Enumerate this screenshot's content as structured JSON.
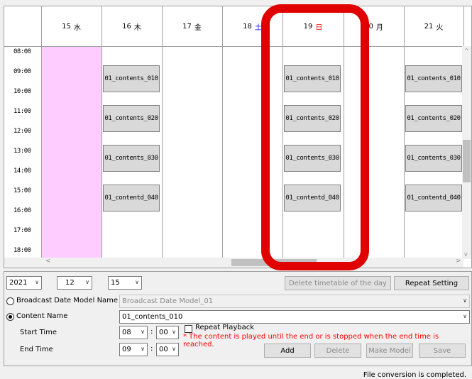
{
  "calendar": {
    "days": [
      {
        "num": "15",
        "dow": "水",
        "kind": "weekday"
      },
      {
        "num": "16",
        "dow": "木",
        "kind": "weekday"
      },
      {
        "num": "17",
        "dow": "金",
        "kind": "weekday"
      },
      {
        "num": "18",
        "dow": "土",
        "kind": "sat"
      },
      {
        "num": "19",
        "dow": "日",
        "kind": "sun"
      },
      {
        "num": "20",
        "dow": "月",
        "kind": "weekday"
      },
      {
        "num": "21",
        "dow": "火",
        "kind": "weekday"
      }
    ],
    "times": [
      "08:00",
      "09:00",
      "10:00",
      "11:00",
      "12:00",
      "13:00",
      "14:00",
      "15:00",
      "16:00",
      "17:00",
      "18:00"
    ],
    "programs": [
      {
        "day": 1,
        "slot": 1,
        "label": "01_contents_010"
      },
      {
        "day": 1,
        "slot": 3,
        "label": "01_contents_020"
      },
      {
        "day": 1,
        "slot": 5,
        "label": "01_contents_030"
      },
      {
        "day": 1,
        "slot": 7,
        "label": "01_contentd_040"
      },
      {
        "day": 4,
        "slot": 1,
        "label": "01_contents_010"
      },
      {
        "day": 4,
        "slot": 3,
        "label": "01_contents_020"
      },
      {
        "day": 4,
        "slot": 5,
        "label": "01_contents_030"
      },
      {
        "day": 4,
        "slot": 7,
        "label": "01_contentd_040"
      },
      {
        "day": 6,
        "slot": 1,
        "label": "01_contents_010"
      },
      {
        "day": 6,
        "slot": 3,
        "label": "01_contents_020"
      },
      {
        "day": 6,
        "slot": 5,
        "label": "01_contents_030"
      },
      {
        "day": 6,
        "slot": 7,
        "label": "01_contentd_040"
      }
    ],
    "today_color": "#ffccff",
    "highlight_color": "#e00000"
  },
  "panel": {
    "year": "2021",
    "month": "12",
    "day": "15",
    "delete_day_btn": "Delete timetable of the day",
    "repeat_setting_btn": "Repeat Setting",
    "broadcast_model_label": "Broadcast Date Model Name",
    "broadcast_model_value": "Broadcast Date Model_01",
    "content_name_label": "Content Name",
    "content_name_value": "01_contents_010",
    "start_time_label": "Start Time",
    "start_hour": "08",
    "start_min": "00",
    "repeat_playback_label": "Repeat Playback",
    "note": "* The content is played until the end or is stopped when the end time is reached.",
    "end_time_label": "End Time",
    "end_hour": "09",
    "end_min": "00",
    "add_btn": "Add",
    "delete_btn": "Delete",
    "make_model_btn": "Make Model",
    "save_btn": "Save",
    "colon": ":"
  },
  "status": "File conversion is completed."
}
